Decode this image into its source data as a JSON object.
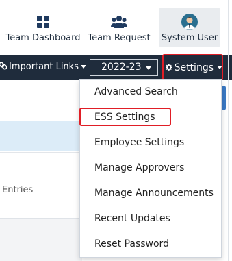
{
  "header": {
    "tiles": [
      {
        "label": "Team Dashboard",
        "icon": "dashboard-grid-icon"
      },
      {
        "label": "Team Request",
        "icon": "users-group-icon"
      },
      {
        "label": "System User",
        "icon": "user-avatar-icon"
      }
    ]
  },
  "navbar": {
    "important_links_label": "Important Links",
    "year_value": "2022-23",
    "settings_label": "Settings",
    "settings_icon": "gear-icon",
    "link_icon": "link-icon"
  },
  "background": {
    "entries_text": "Entries"
  },
  "settings_menu": {
    "items": [
      "Advanced Search",
      "ESS Settings",
      "Employee Settings",
      "Manage Approvers",
      "Manage Announcements",
      "Recent Updates",
      "Reset Password"
    ]
  },
  "colors": {
    "navbar_bg": "#1f2c3c",
    "highlight": "#e01e26",
    "accent_blue": "#3a79c4"
  }
}
